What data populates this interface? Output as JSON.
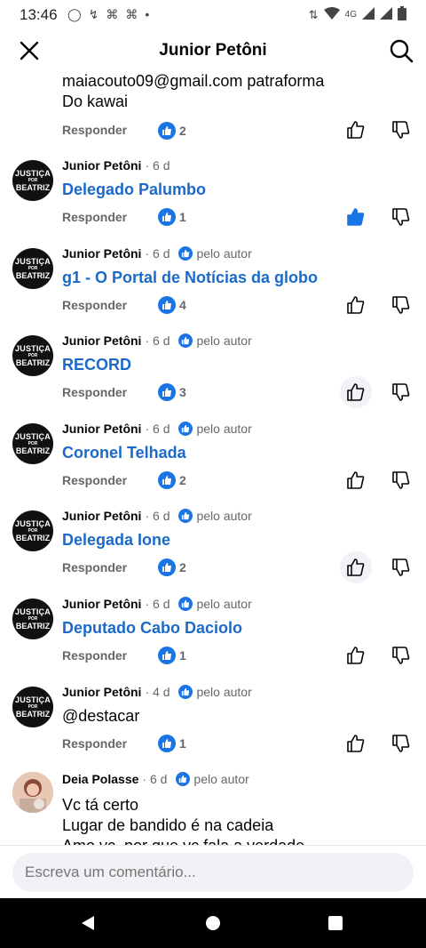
{
  "status_bar": {
    "time": "13:46",
    "network": "4G"
  },
  "header": {
    "title": "Junior Petôni"
  },
  "top_partial": {
    "lines": [
      "maiacouto09@gmail.com patraforma",
      "Do kawai"
    ],
    "likes": "2"
  },
  "labels": {
    "reply": "Responder",
    "author_badge": "pelo autor"
  },
  "avatar_text": {
    "line1": "JUSTIÇA",
    "line2": "POR",
    "line3": "BEATRIZ"
  },
  "comments": [
    {
      "author": "Junior Petôni",
      "time": "6 d",
      "author_badge": false,
      "text": "Delegado Palumbo",
      "is_link": true,
      "likes": "1",
      "liked": true
    },
    {
      "author": "Junior Petôni",
      "time": "6 d",
      "author_badge": true,
      "text": "g1 - O Portal de Notícias da globo",
      "is_link": true,
      "likes": "4",
      "liked": false
    },
    {
      "author": "Junior Petôni",
      "time": "6 d",
      "author_badge": true,
      "text": "RECORD",
      "is_link": true,
      "likes": "3",
      "liked": false
    },
    {
      "author": "Junior Petôni",
      "time": "6 d",
      "author_badge": true,
      "text": "Coronel Telhada",
      "is_link": true,
      "likes": "2",
      "liked": false
    },
    {
      "author": "Junior Petôni",
      "time": "6 d",
      "author_badge": true,
      "text": "Delegada Ione",
      "is_link": true,
      "likes": "2",
      "liked": false
    },
    {
      "author": "Junior Petôni",
      "time": "6 d",
      "author_badge": true,
      "text": "Deputado Cabo Daciolo",
      "is_link": true,
      "likes": "1",
      "liked": false
    },
    {
      "author": "Junior Petôni",
      "time": "4 d",
      "author_badge": true,
      "text": "@destacar",
      "is_link": false,
      "likes": "1",
      "liked": false
    }
  ],
  "last_comment": {
    "author": "Deia Polasse",
    "time": "6 d",
    "lines": [
      "Vc tá certo",
      "Lugar de bandido é  na cadeia",
      "Amo vc, por que vc fala a verdade"
    ]
  },
  "composer": {
    "placeholder": "Escreva um comentário..."
  },
  "colors": {
    "accent": "#1b74e4",
    "link": "#1b6ac9",
    "muted": "#65676b"
  }
}
